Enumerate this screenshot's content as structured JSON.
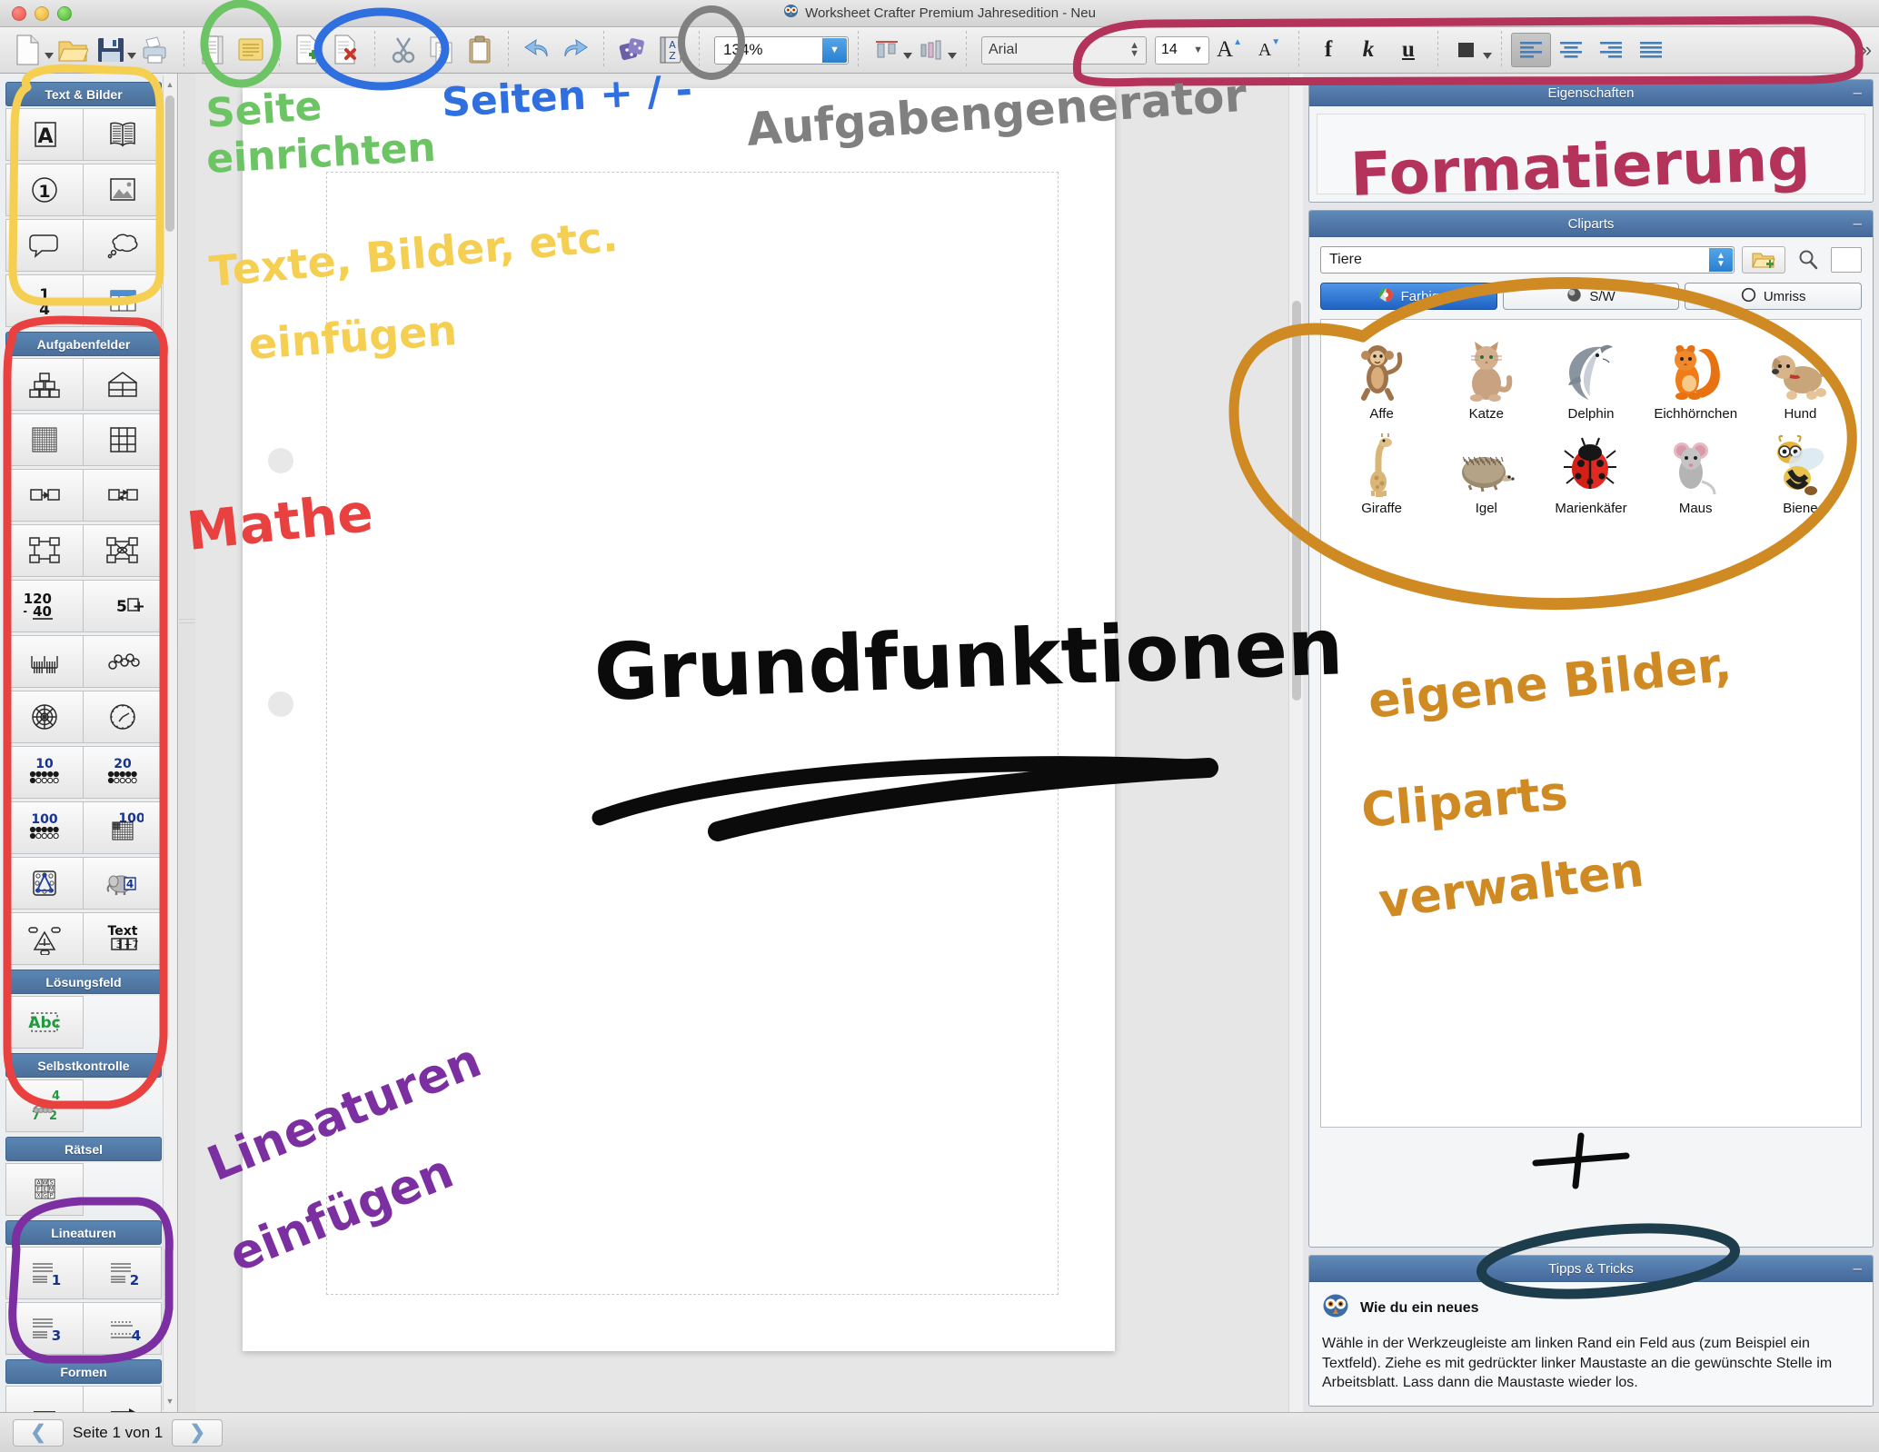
{
  "window": {
    "title": "Worksheet Crafter Premium Jahresedition - Neu",
    "app_icon": "owl-icon"
  },
  "toolbar": {
    "groups": [
      {
        "items": [
          {
            "name": "new-document-button",
            "icon": "new-document-icon",
            "has_caret": true
          },
          {
            "name": "open-folder-button",
            "icon": "open-folder-icon",
            "has_caret": false
          },
          {
            "name": "save-button",
            "icon": "floppy-save-icon",
            "has_caret": true
          },
          {
            "name": "print-button",
            "icon": "printer-icon",
            "has_caret": false
          }
        ]
      },
      {
        "items": [
          {
            "name": "page-setup-button",
            "icon": "page-setup-icon",
            "has_caret": false
          },
          {
            "name": "notes-button",
            "icon": "notepad-icon",
            "has_caret": false
          }
        ]
      },
      {
        "items": [
          {
            "name": "add-page-button",
            "icon": "page-plus-icon",
            "has_caret": false
          },
          {
            "name": "delete-page-button",
            "icon": "page-delete-icon",
            "has_caret": false
          }
        ]
      },
      {
        "items": [
          {
            "name": "cut-button",
            "icon": "scissors-icon",
            "has_caret": false
          },
          {
            "name": "copy-button",
            "icon": "copy-icon",
            "has_caret": false
          },
          {
            "name": "paste-button",
            "icon": "clipboard-icon",
            "has_caret": false
          }
        ]
      },
      {
        "items": [
          {
            "name": "undo-button",
            "icon": "undo-arrow-icon",
            "has_caret": false
          },
          {
            "name": "redo-button",
            "icon": "redo-arrow-icon",
            "has_caret": false
          }
        ]
      },
      {
        "items": [
          {
            "name": "exercise-generator-button",
            "icon": "dice-icon",
            "has_caret": false
          },
          {
            "name": "dictionary-button",
            "icon": "az-book-icon",
            "has_caret": false
          }
        ]
      }
    ],
    "zoom_value": "134%",
    "zoom_dropdown_icon": "chevron-down-icon",
    "align_vertical_button": "align-vertical-icon",
    "align_horizontal_button": "align-horizontal-icon",
    "font_name": "Arial",
    "font_size": "14",
    "increase_font_label": "A",
    "decrease_font_label": "A",
    "bold_label": "f",
    "italic_label": "k",
    "underline_label": "u",
    "text_color_swatch": "#3a3a3a",
    "align_left_icon": "align-left-icon",
    "align_center_icon": "align-center-icon",
    "align_right_icon": "align-right-icon",
    "align_justify_icon": "align-justify-icon",
    "overflow_chevron": "»"
  },
  "sidebar": {
    "sections": [
      {
        "title": "Text & Bilder",
        "rows": [
          [
            {
              "name": "tool-textfield",
              "icon": "letter-a-box-icon"
            },
            {
              "name": "tool-book",
              "icon": "open-book-icon"
            }
          ],
          [
            {
              "name": "tool-numbering",
              "icon": "circled-one-icon"
            },
            {
              "name": "tool-image",
              "icon": "picture-icon"
            }
          ],
          [
            {
              "name": "tool-speech-bubble",
              "icon": "speech-bubble-icon"
            },
            {
              "name": "tool-thought-bubble",
              "icon": "thought-bubble-icon"
            }
          ],
          [
            {
              "name": "tool-fraction",
              "icon": "fraction-one-quarter-icon",
              "label": "1/4"
            },
            {
              "name": "tool-table",
              "icon": "table-icon"
            }
          ]
        ]
      },
      {
        "title": "Aufgabenfelder",
        "rows": [
          [
            {
              "name": "tool-number-pyramid",
              "icon": "number-pyramid-icon"
            },
            {
              "name": "tool-number-house",
              "icon": "number-house-icon"
            }
          ],
          [
            {
              "name": "tool-hundred-field",
              "icon": "hundred-field-icon"
            },
            {
              "name": "tool-grid-nine",
              "icon": "nine-grid-icon"
            }
          ],
          [
            {
              "name": "tool-arrow-chain",
              "icon": "arrow-chain-icon"
            },
            {
              "name": "tool-double-arrow-chain",
              "icon": "double-arrow-chain-icon"
            }
          ],
          [
            {
              "name": "tool-arrow-square",
              "icon": "arrow-square-icon"
            },
            {
              "name": "tool-arrow-cross-square",
              "icon": "arrow-cross-square-icon"
            }
          ],
          [
            {
              "name": "tool-column-addition",
              "icon": "column-sum-icon",
              "label_top": "120",
              "label_bottom": "+ 40"
            },
            {
              "name": "tool-equation-box",
              "icon": "equation-box-icon",
              "label": "5 + □"
            }
          ],
          [
            {
              "name": "tool-number-line",
              "icon": "number-line-icon"
            },
            {
              "name": "tool-bead-chain",
              "icon": "bead-chain-icon"
            }
          ],
          [
            {
              "name": "tool-fraction-circle",
              "icon": "fraction-circle-icon"
            },
            {
              "name": "tool-clock",
              "icon": "clock-icon"
            }
          ],
          [
            {
              "name": "tool-ten-field",
              "icon": "dot-field-icon",
              "label": "10"
            },
            {
              "name": "tool-twenty-field",
              "icon": "dot-field-icon",
              "label": "20"
            }
          ],
          [
            {
              "name": "tool-hundred-dots",
              "icon": "dot-field-icon",
              "label": "100"
            },
            {
              "name": "tool-hundred-grid",
              "icon": "hundred-grid-icon",
              "label": "100"
            }
          ],
          [
            {
              "name": "tool-geoboard",
              "icon": "geoboard-icon"
            },
            {
              "name": "tool-counting-animal",
              "icon": "elephant-four-icon",
              "label": "4"
            }
          ],
          [
            {
              "name": "tool-triangle-sum",
              "icon": "triangle-sum-icon"
            },
            {
              "name": "tool-text-equation",
              "icon": "text-equation-icon",
              "label_top": "Text",
              "label_bottom": "3 + 7"
            }
          ]
        ]
      },
      {
        "title": "Lösungsfeld",
        "rows": [
          [
            {
              "name": "tool-solution-field",
              "icon": "abc-dashed-icon",
              "label": "Abc"
            }
          ]
        ]
      },
      {
        "title": "Selbstkontrolle",
        "rows": [
          [
            {
              "name": "tool-self-check",
              "icon": "caterpillar-check-icon",
              "labels": [
                "4",
                "7",
                "2"
              ]
            }
          ]
        ]
      },
      {
        "title": "Rätsel",
        "rows": [
          [
            {
              "name": "tool-word-search",
              "icon": "word-grid-icon",
              "letters": [
                "A",
                "W",
                "S",
                "F",
                "E",
                "M",
                "X",
                "G",
                "P"
              ]
            }
          ]
        ]
      },
      {
        "title": "Lineaturen",
        "rows": [
          [
            {
              "name": "tool-lineature-1",
              "icon": "lines-icon",
              "label": "1"
            },
            {
              "name": "tool-lineature-2",
              "icon": "lines-icon",
              "label": "2"
            }
          ],
          [
            {
              "name": "tool-lineature-3",
              "icon": "lines-icon",
              "label": "3"
            },
            {
              "name": "tool-lineature-4",
              "icon": "dotted-lines-icon",
              "label": "4"
            }
          ]
        ]
      },
      {
        "title": "Formen",
        "rows": [
          [
            {
              "name": "tool-line",
              "icon": "line-icon"
            },
            {
              "name": "tool-arrow",
              "icon": "arrow-icon"
            }
          ]
        ]
      }
    ]
  },
  "properties_panel": {
    "title": "Eigenschaften",
    "minimize_icon": "minimize-icon"
  },
  "cliparts_panel": {
    "title": "Cliparts",
    "minimize_icon": "minimize-icon",
    "category_value": "Tiere",
    "add_folder_icon": "folder-plus-icon",
    "search_icon": "magnifier-icon",
    "search_value": "",
    "modes": [
      {
        "label": "Farbig",
        "icon": "color-wheel-icon",
        "selected": true
      },
      {
        "label": "S/W",
        "icon": "grayscale-ball-icon",
        "selected": false
      },
      {
        "label": "Umriss",
        "icon": "outline-circle-icon",
        "selected": false
      }
    ],
    "items": [
      {
        "name": "Affe",
        "icon": "monkey-icon"
      },
      {
        "name": "Katze",
        "icon": "cat-icon"
      },
      {
        "name": "Delphin",
        "icon": "dolphin-icon"
      },
      {
        "name": "Eichhörnchen",
        "icon": "squirrel-icon"
      },
      {
        "name": "Hund",
        "icon": "dog-icon"
      },
      {
        "name": "Giraffe",
        "icon": "giraffe-icon"
      },
      {
        "name": "Igel",
        "icon": "hedgehog-icon"
      },
      {
        "name": "Marienkäfer",
        "icon": "ladybug-icon"
      },
      {
        "name": "Maus",
        "icon": "mouse-icon"
      },
      {
        "name": "Biene",
        "icon": "bee-icon"
      }
    ]
  },
  "tips_panel": {
    "title": "Tipps & Tricks",
    "minimize_icon": "minimize-icon",
    "owl_icon": "owl-icon",
    "tip_title": "Wie du ein neues",
    "tip_text": "Wähle in der Werkzeugleiste am linken Rand ein Feld aus (zum Beispiel ein Textfeld). Ziehe es mit gedrückter linker Maustaste an die gewünschte Stelle im Arbeitsblatt. Lass dann die Maustaste wieder los."
  },
  "statusbar": {
    "prev_icon": "chevron-left-icon",
    "page_label": "Seite 1 von 1",
    "next_icon": "chevron-right-icon"
  },
  "annotations": {
    "colors": {
      "green": "#6cc465",
      "blue": "#2f6fe0",
      "gray": "#808080",
      "yellow": "#f5cf52",
      "red": "#e8413f",
      "crimson": "#b4335a",
      "orange": "#cf8a23",
      "purple": "#7b2fa0",
      "black": "#0b0b0b",
      "teal": "#1d3c4c"
    },
    "notes": [
      {
        "text": "Seite\neinrichten",
        "color": "green",
        "name": "annotation-seite-einrichten"
      },
      {
        "text": "Seiten + / -",
        "color": "blue",
        "name": "annotation-seiten-plus-minus"
      },
      {
        "text": "Aufgabengenerator",
        "color": "gray",
        "name": "annotation-aufgabengenerator"
      },
      {
        "text": "Texte, Bilder, etc.\neinfügen",
        "color": "yellow",
        "name": "annotation-texte-bilder-einfuegen"
      },
      {
        "text": "Mathe",
        "color": "red",
        "name": "annotation-mathe"
      },
      {
        "text": "Formatierung",
        "color": "crimson",
        "name": "annotation-formatierung"
      },
      {
        "text": "eigene Bilder,\nCliparts\nverwalten",
        "color": "orange",
        "name": "annotation-eigene-bilder-cliparts-verwalten"
      },
      {
        "text": "Lineaturen\neinfügen",
        "color": "purple",
        "name": "annotation-lineaturen-einfuegen"
      },
      {
        "text": "Grundfunktionen",
        "color": "black",
        "name": "annotation-grundfunktionen"
      }
    ]
  }
}
